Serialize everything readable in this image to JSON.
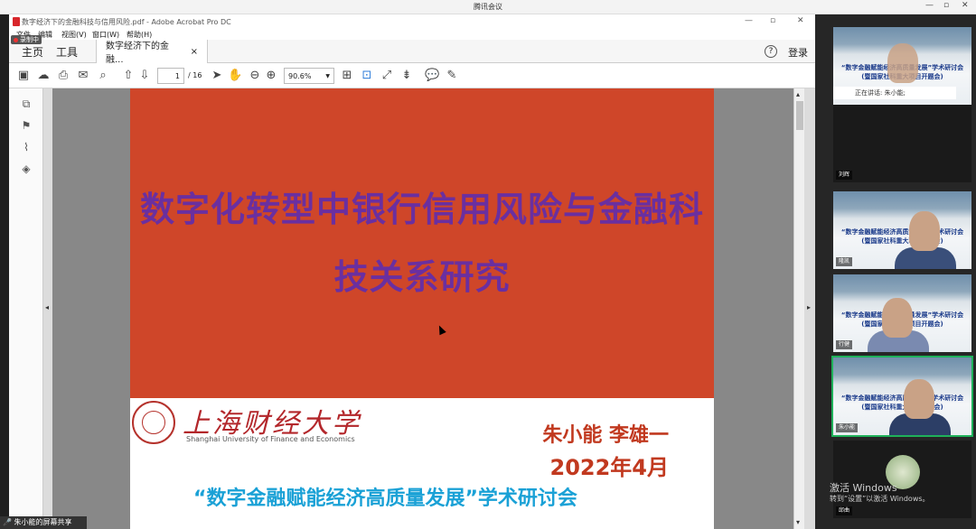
{
  "meeting": {
    "app_title": "腾讯会议",
    "window_controls": [
      "—",
      "▫",
      "✕"
    ]
  },
  "acrobat": {
    "window_title": "数字经济下的金融科技与信用风险.pdf - Adobe Acrobat Pro DC",
    "menu": [
      "文件",
      "编辑",
      "视图(V)",
      "窗口(W)",
      "帮助(H)"
    ],
    "recording_badge": "录制中",
    "tabs": {
      "home": "主页",
      "tools": "工具",
      "doc": "数字经济下的金融...",
      "close": "×"
    },
    "help_icon": "?",
    "login": "登录",
    "page_input": "1",
    "page_total": "/ 16",
    "zoom": "90.6%"
  },
  "slide": {
    "title_line1": "数字化转型中银行信用风险与金融科",
    "title_line2": "技关系研究",
    "university_cn": "上海财经大学",
    "university_en": "Shanghai University of Finance and Economics",
    "authors": "朱小能  李雄一",
    "date": "2022年4月",
    "conference": "“数字金融赋能经济高质量发展”学术研讨会"
  },
  "screenshare_label": "朱小能的屏幕共享",
  "participants": {
    "banner_line1": "“数字金融赋能经济高质量发展”学术研讨会",
    "banner_line2": "(暨国家社科重大项目开题会)",
    "speaking": "正在讲话: 朱小能;",
    "names": [
      "刘辉",
      "隆凯",
      "行健",
      "朱小能",
      "邱曲"
    ]
  },
  "windows_activation": {
    "line1": "激活 Windows",
    "line2": "转到“设置”以激活 Windows。"
  },
  "colors": {
    "slide_red": "#cf4629",
    "title_purple": "#6a2fa0",
    "conference_blue": "#1aa1d6",
    "active_green": "#1fb15a"
  }
}
